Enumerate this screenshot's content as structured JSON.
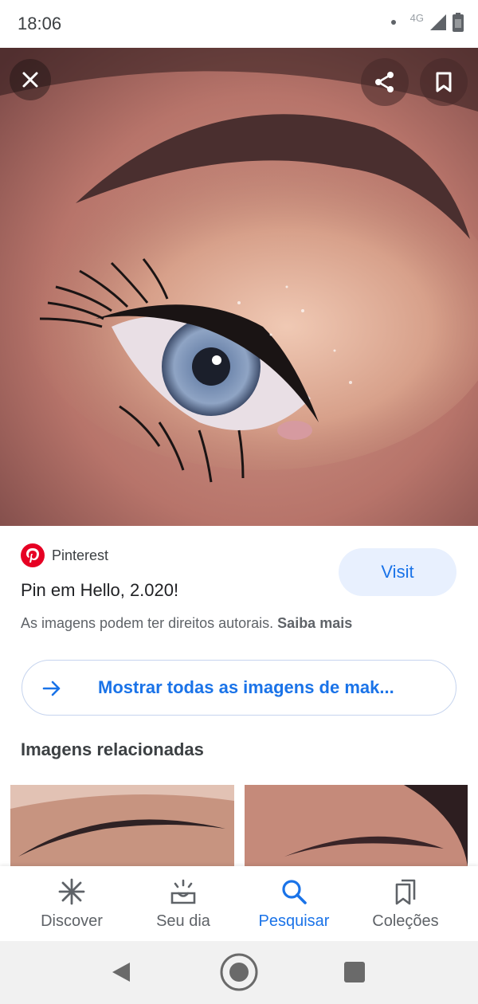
{
  "status_bar": {
    "time": "18:06",
    "network": "4G"
  },
  "hero": {
    "alt_subject": "eye-makeup-photo"
  },
  "source": {
    "name": "Pinterest",
    "brand_color": "#e60023"
  },
  "pin": {
    "title": "Pin em Hello, 2.020!"
  },
  "visit_button": {
    "label": "Visit"
  },
  "rights": {
    "text": "As imagens podem ter direitos autorais.",
    "link": "Saiba mais"
  },
  "show_all": {
    "label": "Mostrar todas as imagens de mak..."
  },
  "related": {
    "title": "Imagens relacionadas"
  },
  "bottom_nav": {
    "items": [
      {
        "label": "Discover",
        "icon": "asterisk-icon",
        "active": false
      },
      {
        "label": "Seu dia",
        "icon": "sunrise-icon",
        "active": false
      },
      {
        "label": "Pesquisar",
        "icon": "search-icon",
        "active": true
      },
      {
        "label": "Coleções",
        "icon": "collections-icon",
        "active": false
      }
    ]
  },
  "colors": {
    "accent": "#1a73e8",
    "accent_bg": "#e8f0fe",
    "text_secondary": "#5f6368"
  }
}
